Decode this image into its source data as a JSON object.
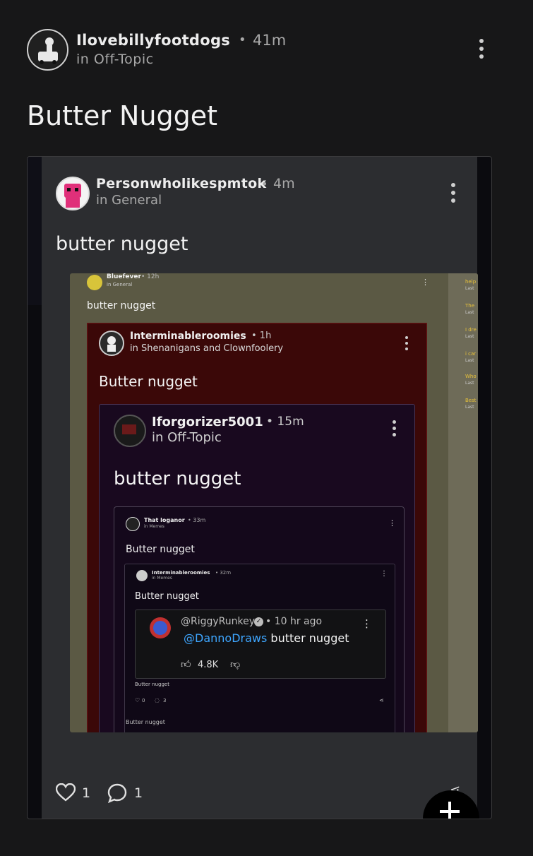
{
  "post": {
    "author": "Ilovebillyfootdogs",
    "sep": "•",
    "time": "41m",
    "community": "in Off-Topic",
    "title": "Butter Nugget"
  },
  "repost": {
    "author": "Personwholikespmtok",
    "sep": "•",
    "time": "4m",
    "community": "in General",
    "title": "butter nugget",
    "likes": "1",
    "comments": "1"
  },
  "shot": {
    "l0": {
      "author": "Bluefever",
      "time": "• 12h",
      "community": "in General",
      "title": "butter nugget"
    },
    "l1": {
      "author": "Interminableroomies",
      "time": "• 1h",
      "community": "in Shenanigans and Clownfoolery",
      "title": "Butter nugget"
    },
    "l2": {
      "author": "Iforgorizer5001",
      "time": "• 15m",
      "community": "in Off-Topic",
      "title": "butter nugget"
    },
    "l3": {
      "author": "That loganor",
      "time": "• 33m",
      "community": "in Memes",
      "title": "Butter nugget"
    },
    "l4": {
      "author": "Interminableroomies",
      "time": "• 32m",
      "community": "in Memes",
      "title": "Butter nugget",
      "caption": "Butter nugget",
      "likes": "0",
      "comments": "3"
    },
    "footer": "Butter nugget",
    "yt": {
      "handle": "@RiggyRunkey",
      "time": "• 10 hr ago",
      "mention": "@DannoDraws",
      "text": " butter nugget",
      "likes": "4.8K"
    },
    "sidebar": [
      "help",
      "Last",
      "The",
      "Last",
      "I dre",
      "Last",
      "i car",
      "Last",
      "Who",
      "Last",
      "Best",
      "Last"
    ]
  },
  "colors": {
    "bg": "#171718",
    "link": "#3ea6ff",
    "yellow": "#e8c23a"
  }
}
